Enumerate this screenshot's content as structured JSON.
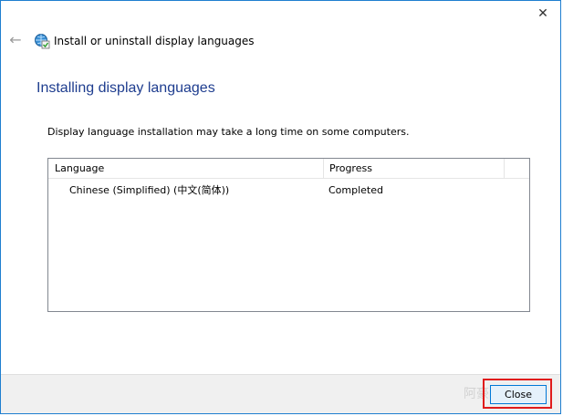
{
  "window": {
    "close_glyph": "✕",
    "back_glyph": "←",
    "app_icon": "globe-language-icon",
    "title": "Install or uninstall display languages"
  },
  "content": {
    "heading": "Installing display languages",
    "intro": "Display language installation may take a long time on some computers."
  },
  "list": {
    "columns": [
      "Language",
      "Progress"
    ],
    "rows": [
      {
        "language": "Chinese (Simplified) (中文(简体))",
        "progress": "Completed"
      }
    ]
  },
  "footer": {
    "close_label": "Close",
    "watermark": "阿豪"
  },
  "colors": {
    "accent": "#1f7fd0",
    "heading": "#1e3d8f",
    "highlight": "#e01b1b"
  }
}
